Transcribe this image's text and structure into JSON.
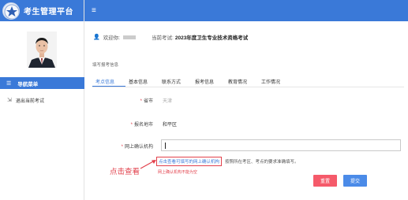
{
  "app": {
    "title": "考生管理平台"
  },
  "sidebar": {
    "nav_header": "导航菜单",
    "items": [
      {
        "label": "退出当前考试"
      }
    ]
  },
  "header": {
    "welcome_label": "欢迎你:",
    "exam_label": "当前考试:",
    "exam_name": "2023年度卫生专业技术资格考试"
  },
  "section": {
    "title": "填写报考信息"
  },
  "tabs": [
    {
      "label": "考点信息",
      "active": true
    },
    {
      "label": "基本信息",
      "active": false
    },
    {
      "label": "联系方式",
      "active": false
    },
    {
      "label": "报考信息",
      "active": false
    },
    {
      "label": "教育情况",
      "active": false
    },
    {
      "label": "工作情况",
      "active": false
    }
  ],
  "form": {
    "province": {
      "label": "省市",
      "value": "天津"
    },
    "city": {
      "label": "报名地市",
      "value": "和平区"
    },
    "confirm_org": {
      "label": "网上确认机构",
      "value": ""
    }
  },
  "hint": {
    "link": "点击查看可填写的网上确认机构",
    "text": "按照所在考区、考点的要求准确填写。"
  },
  "error": "网上确认机构不能为空",
  "annotation": "点击查看",
  "buttons": {
    "reset": "重置",
    "submit": "提交"
  },
  "colors": {
    "primary": "#3a79d8",
    "danger": "#e2414c",
    "reset": "#f55a6a",
    "submit": "#4b8be8"
  }
}
